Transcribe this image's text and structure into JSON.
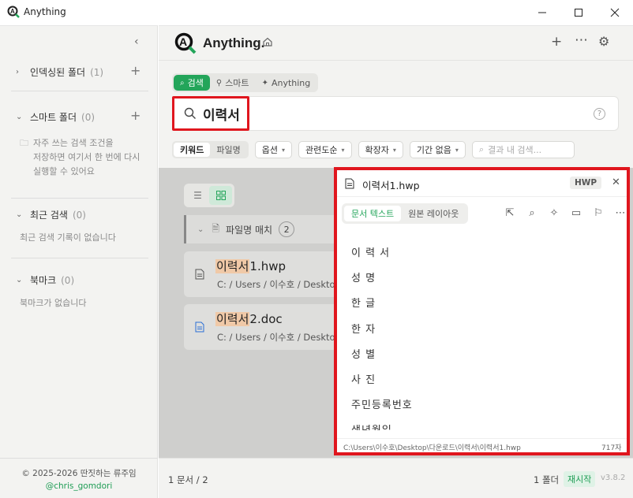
{
  "window": {
    "title": "Anything",
    "icons": {
      "minimize": "minimize-icon",
      "maximize": "maximize-icon",
      "close": "close-icon"
    }
  },
  "sidebar": {
    "sections": [
      {
        "label": "인덱싱된 폴더",
        "count": "(1)"
      },
      {
        "label": "스마트 폴더",
        "count": "(0)"
      },
      {
        "label": "최근 검색",
        "count": "(0)"
      },
      {
        "label": "북마크",
        "count": "(0)"
      }
    ],
    "smart_hint_lines": [
      "자주 쓰는 검색 조건을",
      "저장하면 여기서 한 번에 다시",
      "실행할 수 있어요"
    ],
    "recent_empty": "최근 검색 기록이 없습니다",
    "bookmark_empty": "북마크가 없습니다",
    "footer_line1": "© 2025-2026 딴짓하는 류주임",
    "footer_line2": "@chris_gomdori"
  },
  "header": {
    "logo_text": "Anything."
  },
  "modes": [
    {
      "label": "검색",
      "icon": "search-icon"
    },
    {
      "label": "스마트",
      "icon": "magic-wand-icon"
    },
    {
      "label": "Anything",
      "icon": "sparkle-icon"
    }
  ],
  "search": {
    "query": "이력서"
  },
  "filters": {
    "segment": [
      "키워드",
      "파일명"
    ],
    "buttons": [
      "옵션",
      "관련도순",
      "확장자",
      "기간 없음"
    ],
    "within_placeholder": "결과 내 검색..."
  },
  "results": {
    "group_label": "파일명 매치",
    "group_count": "2",
    "items": [
      {
        "highlight": "이력서",
        "rest": "1.hwp",
        "path": "C: /  Users  /  이수호  /  Deskto"
      },
      {
        "highlight": "이력서",
        "rest": "2.doc",
        "path": "C: /  Users  /  이수호  /  Deskto"
      }
    ]
  },
  "preview": {
    "file_name": "이력서1.hwp",
    "ext_badge": "HWP",
    "tabs": [
      "문서 텍스트",
      "원본 레이아웃"
    ],
    "lines": [
      "이 력 서",
      "성 명",
      "한 글",
      "한 자",
      "성 별",
      "사 진",
      "주민등록번호",
      "생년월일"
    ],
    "path": "C:\\Users\\이수호\\Desktop\\다운로드\\이력서\\이력서1.hwp",
    "char_count": "717자"
  },
  "status": {
    "left": "1 문서 / 2",
    "folder_count": "1 폴더",
    "restart": "재시작",
    "version": "v3.8.2"
  },
  "accent": "#23a55a",
  "highlight_red": "#e0161e"
}
